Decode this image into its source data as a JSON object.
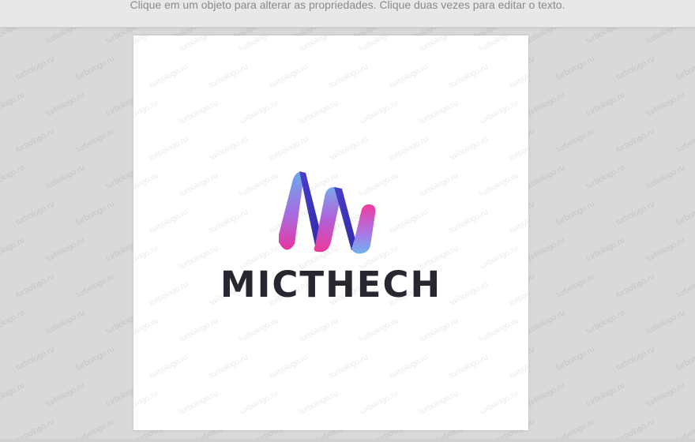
{
  "hint": {
    "text": "Clique em um objeto para alterar as propriedades. Clique duas vezes para editar o texto."
  },
  "watermark": {
    "text": "turbologo.ru"
  },
  "logo": {
    "brand_name": "MICTHECH",
    "icon": "wave-m-logo-icon",
    "colors": {
      "blue": "#6aa9ec",
      "pink": "#e8359f",
      "purple": "#3b35b8",
      "text": "#2a2630"
    }
  }
}
